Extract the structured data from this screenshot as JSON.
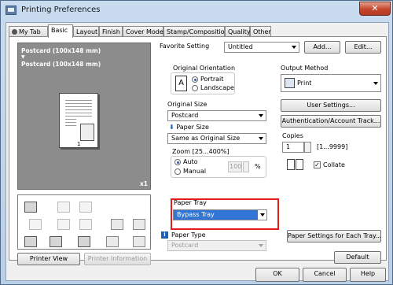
{
  "window": {
    "title": "Printing Preferences",
    "close_glyph": "✕"
  },
  "tabs": [
    {
      "label": "My Tab",
      "icon": "user-icon"
    },
    {
      "label": "Basic"
    },
    {
      "label": "Layout"
    },
    {
      "label": "Finish"
    },
    {
      "label": "Cover Mode"
    },
    {
      "label": "Stamp/Composition"
    },
    {
      "label": "Quality"
    },
    {
      "label": "Other"
    }
  ],
  "preview": {
    "line1": "Postcard (100x148 mm)",
    "arrow": "▼",
    "line2": "Postcard (100x148 mm)",
    "page_number": "1",
    "copies_badge": "x1"
  },
  "preview_buttons": {
    "printer_view": "Printer View",
    "printer_information": "Printer Information"
  },
  "favorite": {
    "label": "Favorite Setting",
    "value": "Untitled",
    "add_button": "Add...",
    "edit_button": "Edit..."
  },
  "orientation": {
    "label": "Original Orientation",
    "options": [
      "Portrait",
      "Landscape"
    ],
    "selected": "Portrait"
  },
  "original_size": {
    "label": "Original Size",
    "value": "Postcard"
  },
  "paper_size": {
    "label": "Paper Size",
    "value": "Same as Original Size"
  },
  "zoom": {
    "label": "Zoom [25...400%]",
    "options": [
      "Auto",
      "Manual"
    ],
    "selected": "Auto",
    "value": "100",
    "unit": "%"
  },
  "paper_tray": {
    "label": "Paper Tray",
    "value": "Bypass Tray"
  },
  "paper_type": {
    "label": "Paper Type",
    "value": "Postcard"
  },
  "output_method": {
    "label": "Output Method",
    "value": "Print"
  },
  "right_buttons": {
    "user_settings": "User Settings...",
    "auth_tracking": "Authentication/Account Track..."
  },
  "copies": {
    "label": "Copies",
    "value": "1",
    "range": "[1...9999]",
    "collate_label": "Collate",
    "collate_checked": true
  },
  "paper_settings_button": "Paper Settings for Each Tray...",
  "default_button": "Default",
  "dialog_buttons": {
    "ok": "OK",
    "cancel": "Cancel",
    "help": "Help"
  }
}
